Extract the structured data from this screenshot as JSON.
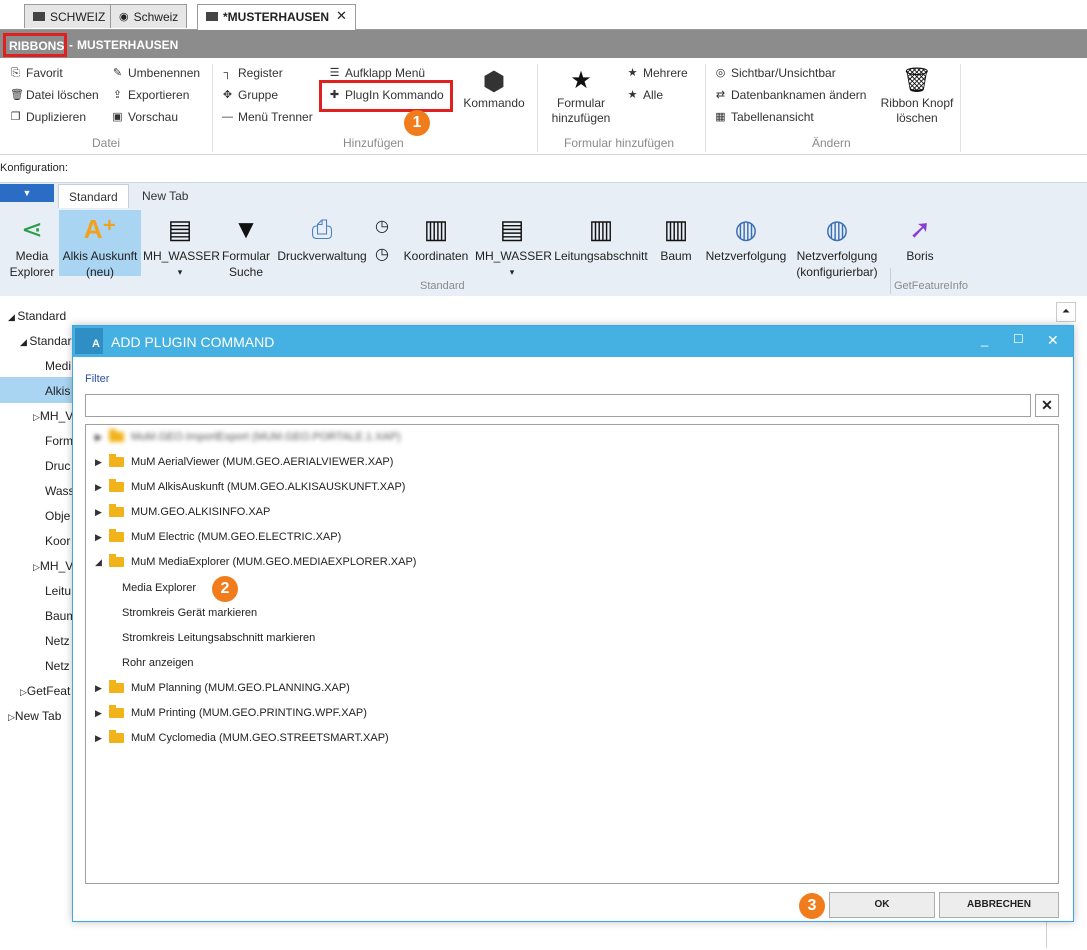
{
  "tabs": [
    {
      "label": "SCHWEIZ"
    },
    {
      "label": "Schweiz"
    },
    {
      "label": "*MUSTERHAUSEN"
    }
  ],
  "title": {
    "ribbons": "RIBBONS",
    "separator": "-",
    "project": "MUSTERHAUSEN"
  },
  "ribbon": {
    "datei": {
      "items": [
        "Favorit",
        "Datei löschen",
        "Duplizieren",
        "Umbenennen",
        "Exportieren",
        "Vorschau"
      ],
      "label": "Datei"
    },
    "hinzufuegen": {
      "items": [
        "Register",
        "Gruppe",
        "Menü Trenner",
        "Aufklapp Menü",
        "PlugIn Kommando"
      ],
      "kommando": "Kommando",
      "label": "Hinzufügen"
    },
    "formular": {
      "big": [
        "Formular",
        "hinzufügen"
      ],
      "items": [
        "Mehrere",
        "Alle"
      ],
      "label": "Formular hinzufügen"
    },
    "aendern": {
      "items": [
        "Sichtbar/Unsichtbar",
        "Datenbanknamen ändern",
        "Tabellenansicht"
      ],
      "big": [
        "Ribbon Knopf",
        "löschen"
      ],
      "label": "Ändern"
    }
  },
  "konfiguration": "Konfiguration:",
  "config_tabs": [
    "Standard",
    "New Tab"
  ],
  "config_buttons": [
    {
      "l1": "Media",
      "l2": "Explorer"
    },
    {
      "l1": "Alkis Auskunft",
      "l2": "(neu)"
    },
    {
      "l1": "MH_WASSER",
      "l2": "▾"
    },
    {
      "l1": "Formular",
      "l2": "Suche"
    },
    {
      "l1": "Druckverwaltung",
      "l2": ""
    },
    {
      "l1": "Koordinaten",
      "l2": ""
    },
    {
      "l1": "MH_WASSER",
      "l2": "▾"
    },
    {
      "l1": "Leitungsabschnitt",
      "l2": ""
    },
    {
      "l1": "Baum",
      "l2": ""
    },
    {
      "l1": "Netzverfolgung",
      "l2": ""
    },
    {
      "l1": "Netzverfolgung",
      "l2": "(konfigurierbar)"
    },
    {
      "l1": "Boris",
      "l2": ""
    }
  ],
  "config_groups": {
    "standard": "Standard",
    "getfeature": "GetFeatureInfo"
  },
  "tree": [
    "Standard",
    "Standard",
    "Medi",
    "Alkis",
    "MH_V",
    "Form",
    "Druc",
    "Wass",
    "Obje",
    "Koor",
    "MH_V",
    "Leitu",
    "Baum",
    "Netz",
    "Netz",
    "GetFeat",
    "New Tab"
  ],
  "dialog": {
    "title": "ADD PLUGIN COMMAND",
    "filter_label": "Filter",
    "filter_value": "",
    "folders_top": [
      "MuM.GEO.ImportExport (MUM.GEO.PORTALE.1.XAP)",
      "MuM AerialViewer (MUM.GEO.AERIALVIEWER.XAP)",
      "MuM AlkisAuskunft (MUM.GEO.ALKISAUSKUNFT.XAP)",
      "MUM.GEO.ALKISINFO.XAP",
      "MuM Electric (MUM.GEO.ELECTRIC.XAP)",
      "MuM MediaExplorer (MUM.GEO.MEDIAEXPLORER.XAP)"
    ],
    "commands": [
      "Media Explorer",
      "Stromkreis Gerät markieren",
      "Stromkreis Leitungsabschnitt markieren",
      "Rohr anzeigen"
    ],
    "folders_bottom": [
      "MuM Planning (MUM.GEO.PLANNING.XAP)",
      "MuM Printing (MUM.GEO.PRINTING.WPF.XAP)",
      "MuM Cyclomedia (MUM.GEO.STREETSMART.XAP)"
    ],
    "ok": "OK",
    "cancel": "ABBRECHEN"
  },
  "badges": [
    "1",
    "2",
    "3"
  ],
  "colors": {
    "accent": "#45b1e3",
    "highlight": "#e0201e",
    "badge": "#f07c1c",
    "selected": "#a9d4f2"
  }
}
